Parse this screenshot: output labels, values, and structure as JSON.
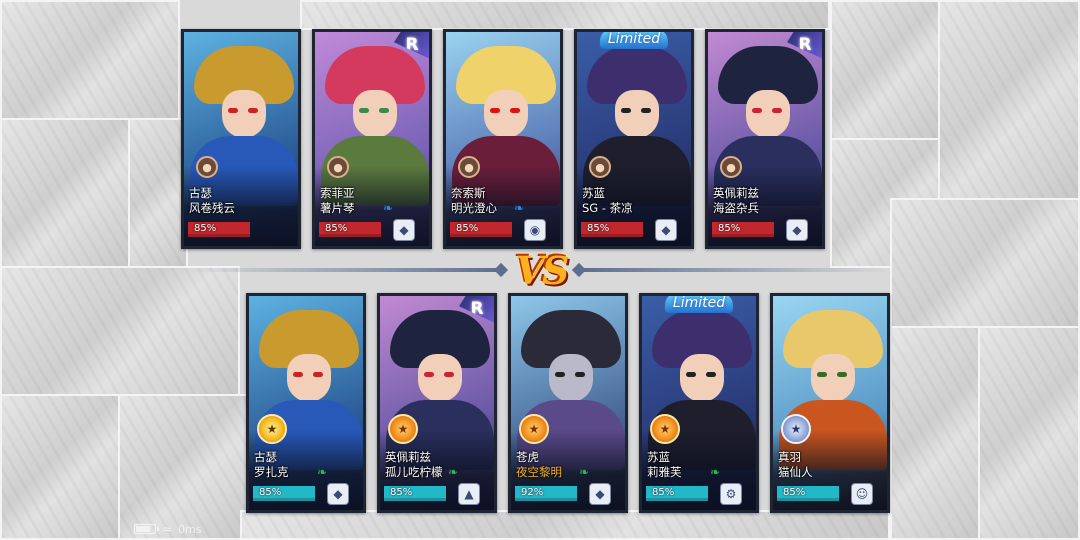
{
  "top_team": [
    {
      "line1": "古瑟",
      "line2": "风卷残云",
      "percent": "85%",
      "rank": "",
      "limited": "",
      "pet": "gear-pet",
      "wing": ""
    },
    {
      "line1": "索菲亚",
      "line2": "薯片琴",
      "percent": "85%",
      "rank": "R",
      "limited": "",
      "pet": "bird-pet",
      "wing": "blue"
    },
    {
      "line1": "奈索斯",
      "line2": "明光澄心",
      "percent": "85%",
      "rank": "",
      "limited": "",
      "pet": "robot-pet",
      "wing": "blue"
    },
    {
      "line1": "苏蓝",
      "line2": "SG - 茶凉",
      "percent": "85%",
      "rank": "",
      "limited": "Limited",
      "pet": "bird-pet",
      "wing": ""
    },
    {
      "line1": "英佩莉兹",
      "line2": "海盗杂兵",
      "percent": "85%",
      "rank": "R",
      "limited": "",
      "pet": "bird-pet",
      "wing": ""
    }
  ],
  "bottom_team": [
    {
      "line1": "古瑟",
      "line2": "罗扎克",
      "percent": "85%",
      "rank": "",
      "limited": "",
      "pet": "bird-pet",
      "wing": "green"
    },
    {
      "line1": "英佩莉兹",
      "line2": "孤儿吃柠檬",
      "percent": "85%",
      "rank": "R",
      "limited": "",
      "pet": "dragon-pet",
      "wing": "green"
    },
    {
      "line1": "苍虎",
      "line2": "夜空黎明",
      "line2_highlight": true,
      "percent": "92%",
      "rank": "",
      "limited": "",
      "pet": "bird-pet",
      "wing": "green"
    },
    {
      "line1": "苏蓝",
      "line2": "莉雅芙",
      "percent": "85%",
      "rank": "",
      "limited": "Limited",
      "pet": "gear-pet",
      "wing": "green"
    },
    {
      "line1": "真羽",
      "line2": "猫仙人",
      "percent": "85%",
      "rank": "",
      "limited": "",
      "pet": "face-pet",
      "wing": ""
    }
  ],
  "vs_label": "VS",
  "status_bar": {
    "ping": "0ms"
  }
}
